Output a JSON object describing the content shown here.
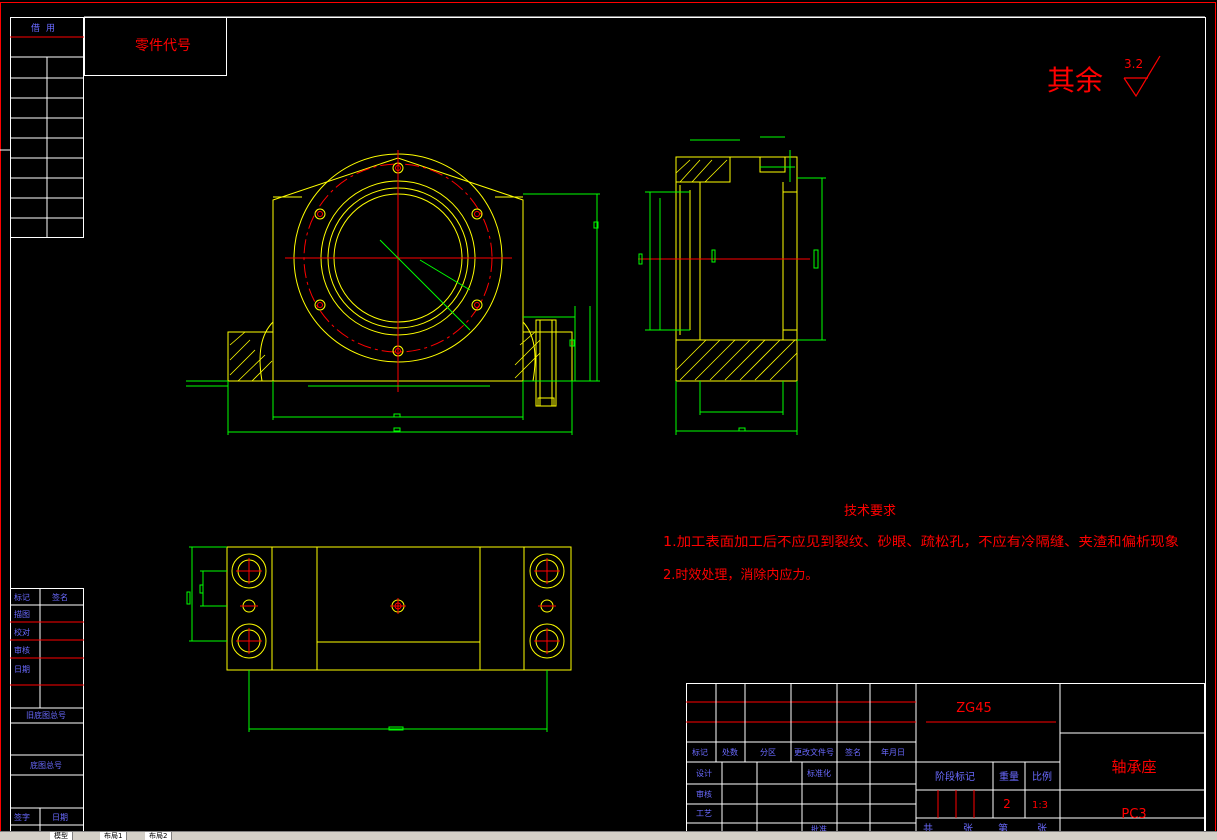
{
  "drawing": {
    "part_code_label": "零件代号",
    "surface_finish": {
      "prefix": "其余",
      "value": "3.2"
    },
    "tech_requirements": {
      "title": "技术要求",
      "items": [
        "1.加工表面加工后不应见到裂纹、砂眼、疏松孔，不应有冷隔缝、夹渣和偏析现象",
        "2.时效处理，消除内应力。"
      ]
    },
    "title_block": {
      "material": "ZG45",
      "part_name": "轴承座",
      "drawing_no": "PC3",
      "quantity": "2",
      "scale": "1:3",
      "mark_headers": [
        "标记",
        "处数",
        "分区",
        "更改文件号",
        "签名",
        "年月日"
      ],
      "role_labels": [
        "设计",
        "审核",
        "工艺"
      ],
      "std_label": "标准化",
      "approve_label": "批准",
      "stage_headers": [
        "阶段标记",
        "重量",
        "比例"
      ],
      "sheet_footer": [
        "共",
        "张",
        "第",
        "张"
      ]
    },
    "left_strip": {
      "top_label": "借用",
      "mid_labels": [
        "描图",
        "校对",
        "审核",
        "日期"
      ],
      "labels_lower": [
        "旧底图总号",
        "底图总号",
        "签字"
      ],
      "sign_header": [
        "标记",
        "签名"
      ]
    }
  },
  "colors": {
    "background": "#000000",
    "frame": "#ff0000",
    "outline": "#ffff00",
    "dimension": "#00ff00",
    "centerline": "#ff0000",
    "text_red": "#ff0000",
    "text_blue": "#6a6aff",
    "white_line": "#ffffff"
  },
  "tabs": [
    "模型",
    "布局1",
    "布局2"
  ]
}
